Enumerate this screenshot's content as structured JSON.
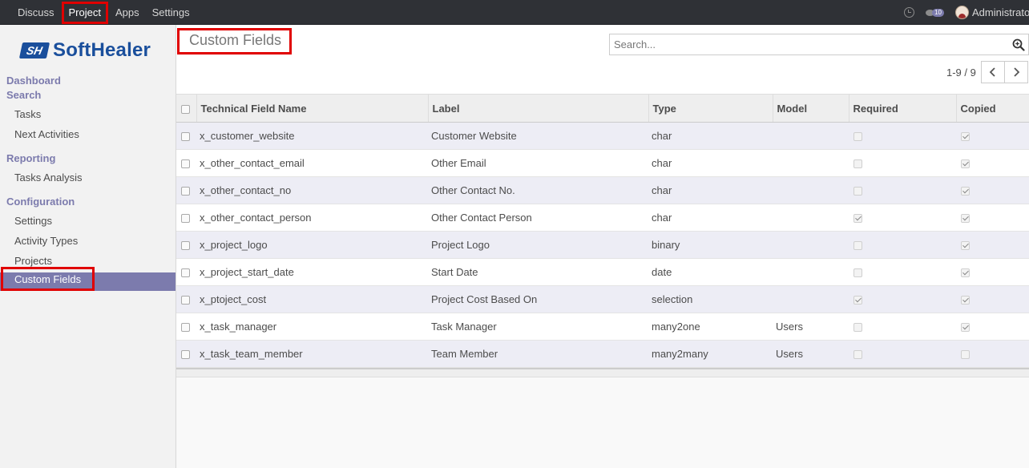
{
  "navbar": {
    "items": [
      {
        "label": "Discuss"
      },
      {
        "label": "Project"
      },
      {
        "label": "Apps"
      },
      {
        "label": "Settings"
      }
    ],
    "chat_badge": "10",
    "user_name": "Administrator"
  },
  "sidebar": {
    "logo_text": "SoftHealer",
    "sections": {
      "dashboard": "Dashboard",
      "search": "Search",
      "tasks": "Tasks",
      "next_activities": "Next Activities",
      "reporting": "Reporting",
      "tasks_analysis": "Tasks Analysis",
      "configuration": "Configuration",
      "settings": "Settings",
      "activity_types": "Activity Types",
      "projects": "Projects",
      "custom_fields": "Custom Fields"
    }
  },
  "main": {
    "title": "Custom Fields",
    "search_placeholder": "Search...",
    "pager": "1-9 / 9",
    "columns": [
      "Technical Field Name",
      "Label",
      "Type",
      "Model",
      "Required",
      "Copied"
    ],
    "rows": [
      {
        "name": "x_customer_website",
        "label": "Customer Website",
        "type": "char",
        "model": "",
        "required": false,
        "copied": true
      },
      {
        "name": "x_other_contact_email",
        "label": "Other Email",
        "type": "char",
        "model": "",
        "required": false,
        "copied": true
      },
      {
        "name": "x_other_contact_no",
        "label": "Other Contact No.",
        "type": "char",
        "model": "",
        "required": false,
        "copied": true
      },
      {
        "name": "x_other_contact_person",
        "label": "Other Contact Person",
        "type": "char",
        "model": "",
        "required": true,
        "copied": true
      },
      {
        "name": "x_project_logo",
        "label": "Project Logo",
        "type": "binary",
        "model": "",
        "required": false,
        "copied": true
      },
      {
        "name": "x_project_start_date",
        "label": "Start Date",
        "type": "date",
        "model": "",
        "required": false,
        "copied": true
      },
      {
        "name": "x_ptoject_cost",
        "label": "Project Cost Based On",
        "type": "selection",
        "model": "",
        "required": true,
        "copied": true
      },
      {
        "name": "x_task_manager",
        "label": "Task Manager",
        "type": "many2one",
        "model": "Users",
        "required": false,
        "copied": true
      },
      {
        "name": "x_task_team_member",
        "label": "Team Member",
        "type": "many2many",
        "model": "Users",
        "required": false,
        "copied": false
      }
    ]
  },
  "colors": {
    "navbar_bg": "#2f3136",
    "accent": "#7c7bad",
    "highlight": "#e00000"
  }
}
